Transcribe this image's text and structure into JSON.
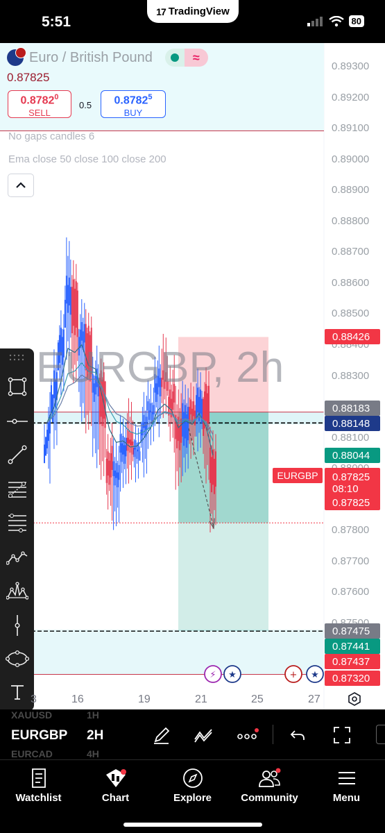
{
  "status_bar": {
    "time": "5:51",
    "app_pill": "TradingView",
    "battery": "80"
  },
  "instrument": {
    "title": "Euro / British Pound",
    "last_price": "0.87825",
    "sell": {
      "price": "0.8782",
      "price_sup": "0",
      "label": "SELL"
    },
    "spread": "0.5",
    "buy": {
      "price": "0.8782",
      "price_sup": "5",
      "label": "BUY"
    },
    "wave_icon": "≈"
  },
  "indicators": [
    "No gaps candles 6",
    "Ema close 50 close 100 close 200"
  ],
  "watermark": "EURGBP, 2h",
  "price_axis": [
    "0.89300",
    "0.89200",
    "0.89100",
    "0.89000",
    "0.88900",
    "0.88800",
    "0.88700",
    "0.88600",
    "0.88500",
    "0.88400",
    "0.88300",
    "0.88100",
    "0.88000",
    "0.87800",
    "0.87700",
    "0.87600",
    "0.87500"
  ],
  "price_tags": [
    {
      "value": "0.88426",
      "color": "#f23645"
    },
    {
      "value": "0.88183",
      "color": "#787b86"
    },
    {
      "value": "0.88148",
      "color": "#1e3a8a"
    },
    {
      "value": "0.88044",
      "color": "#089981"
    },
    {
      "value": "0.87825",
      "sub": "08:10",
      "color": "#f23645"
    },
    {
      "value": "0.87825",
      "color": "#f23645"
    },
    {
      "value": "0.87475",
      "color": "#787b86"
    },
    {
      "value": "0.87441",
      "color": "#089981"
    },
    {
      "value": "0.87437",
      "color": "#f23645"
    },
    {
      "value": "0.87320",
      "color": "#f23645"
    }
  ],
  "symbol_tag": "EURGBP",
  "time_axis": [
    "3",
    "16",
    "19",
    "21",
    "25",
    "27"
  ],
  "chart_data": {
    "type": "candlestick",
    "symbol": "EURGBP",
    "timeframe": "2h",
    "ylim": [
      0.873,
      0.8935
    ],
    "ohlc": [
      [
        0.8805,
        0.882,
        0.88,
        0.8815
      ],
      [
        0.8815,
        0.8835,
        0.881,
        0.883
      ],
      [
        0.883,
        0.885,
        0.8825,
        0.8845
      ],
      [
        0.8845,
        0.887,
        0.884,
        0.886
      ],
      [
        0.886,
        0.8865,
        0.883,
        0.8835
      ],
      [
        0.8835,
        0.885,
        0.882,
        0.8845
      ],
      [
        0.8845,
        0.8848,
        0.8815,
        0.882
      ],
      [
        0.882,
        0.8835,
        0.8805,
        0.883
      ],
      [
        0.883,
        0.8832,
        0.88,
        0.8805
      ],
      [
        0.8805,
        0.881,
        0.8788,
        0.8792
      ],
      [
        0.8792,
        0.8805,
        0.8785,
        0.88
      ],
      [
        0.88,
        0.8815,
        0.8795,
        0.881
      ],
      [
        0.881,
        0.8818,
        0.88,
        0.8803
      ],
      [
        0.8803,
        0.8812,
        0.8798,
        0.8808
      ],
      [
        0.8808,
        0.882,
        0.8802,
        0.8815
      ],
      [
        0.8815,
        0.8825,
        0.881,
        0.882
      ],
      [
        0.882,
        0.8835,
        0.8815,
        0.883
      ],
      [
        0.883,
        0.884,
        0.882,
        0.8825
      ],
      [
        0.8825,
        0.8832,
        0.881,
        0.8815
      ],
      [
        0.8815,
        0.8822,
        0.8798,
        0.8802
      ],
      [
        0.8802,
        0.8826,
        0.88,
        0.882
      ],
      [
        0.882,
        0.8823,
        0.8808,
        0.8812
      ],
      [
        0.8812,
        0.883,
        0.8808,
        0.8825
      ],
      [
        0.8825,
        0.8828,
        0.88,
        0.8805
      ],
      [
        0.8805,
        0.881,
        0.8783,
        0.8786
      ]
    ],
    "ema_lines": [
      "close 50",
      "close 100",
      "close 200"
    ],
    "short_position": {
      "entry": 0.88183,
      "stop": 0.88426,
      "target": 0.87475
    },
    "horizontal_lines": [
      0.88148,
      0.87825,
      0.87475
    ]
  },
  "tools": [
    "square-corners-icon",
    "horizontal-line-icon",
    "trend-line-icon",
    "fib-retracement-icon",
    "fib-levels-icon",
    "zigzag-icon",
    "pattern-icon",
    "vertical-line-icon",
    "ellipse-icon",
    "text-tool-icon"
  ],
  "symbol_strip": {
    "ghost_top": "XAUUSD",
    "ghost_top_tf": "1H",
    "symbol": "EURGBP",
    "timeframe": "2H",
    "ghost_bottom": "EURCAD",
    "ghost_bottom_tf": "4H"
  },
  "tabs": [
    {
      "label": "Watchlist",
      "icon": "watchlist-icon"
    },
    {
      "label": "Chart",
      "icon": "chart-icon"
    },
    {
      "label": "Explore",
      "icon": "compass-icon"
    },
    {
      "label": "Community",
      "icon": "community-icon"
    },
    {
      "label": "Menu",
      "icon": "menu-icon"
    }
  ]
}
